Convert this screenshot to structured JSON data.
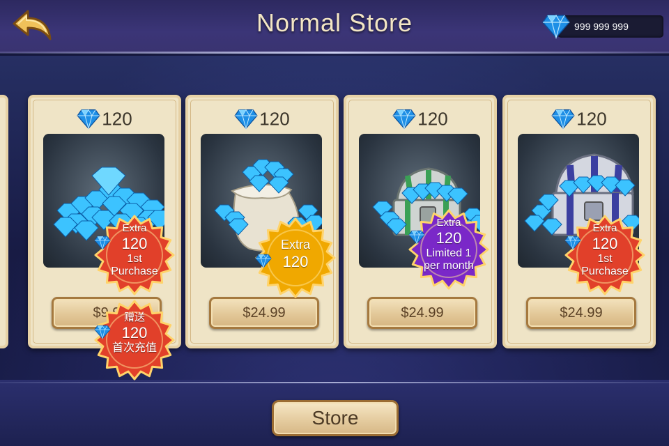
{
  "header": {
    "title": "Normal Store",
    "currency": {
      "icon": "diamond-icon",
      "amount": "999 999 999"
    }
  },
  "cards": [
    {
      "price_gems": "120",
      "art": "diamond-pile",
      "buy_label": "$9.9",
      "badges": [
        {
          "line1": "Extra",
          "amount": "120",
          "line2": "1st",
          "line3": "Purchase",
          "color": "#e1402a"
        },
        {
          "line1": "赠送",
          "amount": "120",
          "line2": "首次充值",
          "line3": "",
          "color": "#e1402a"
        }
      ]
    },
    {
      "price_gems": "120",
      "art": "diamond-sack",
      "buy_label": "$24.99",
      "badges": [
        {
          "line1": "Extra",
          "amount": "120",
          "line2": "",
          "line3": "",
          "color": "#f0a800"
        }
      ]
    },
    {
      "price_gems": "120",
      "art": "diamond-chest-green",
      "buy_label": "$24.99",
      "badges": [
        {
          "line1": "Extra",
          "amount": "120",
          "line2": "Limited 1",
          "line3": "per month",
          "color": "#7a28c8"
        }
      ]
    },
    {
      "price_gems": "120",
      "art": "diamond-chest-blue",
      "buy_label": "$24.99",
      "badges": [
        {
          "line1": "Extra",
          "amount": "120",
          "line2": "1st",
          "line3": "Purchase",
          "color": "#e1402a"
        }
      ]
    }
  ],
  "footer": {
    "store_label": "Store"
  },
  "colors": {
    "gem": "#2aa8f0",
    "card_bg": "#efe4c6",
    "title": "#f3e6c4"
  }
}
